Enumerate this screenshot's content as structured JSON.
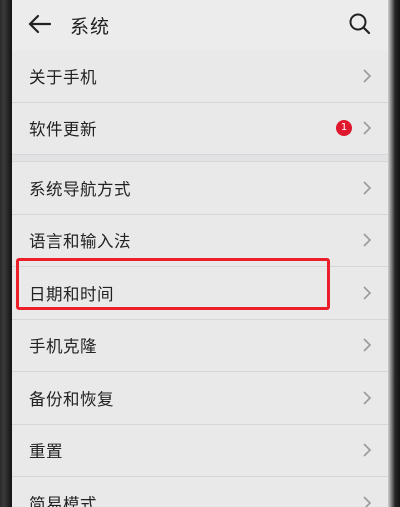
{
  "header": {
    "title": "系统"
  },
  "icons": {
    "back": "back-arrow-icon",
    "search": "search-icon",
    "chevron": "chevron-right-icon"
  },
  "colors": {
    "badge": "#e0182d",
    "highlight": "#ea1f2a",
    "background": "#e9e9ea"
  },
  "menu": {
    "items": [
      {
        "label": "关于手机"
      },
      {
        "label": "软件更新",
        "badge": "1"
      },
      {
        "label": "系统导航方式"
      },
      {
        "label": "语言和输入法"
      },
      {
        "label": "日期和时间"
      },
      {
        "label": "手机克隆",
        "highlighted": true
      },
      {
        "label": "备份和恢复"
      },
      {
        "label": "重置"
      },
      {
        "label": "简易模式"
      }
    ]
  }
}
